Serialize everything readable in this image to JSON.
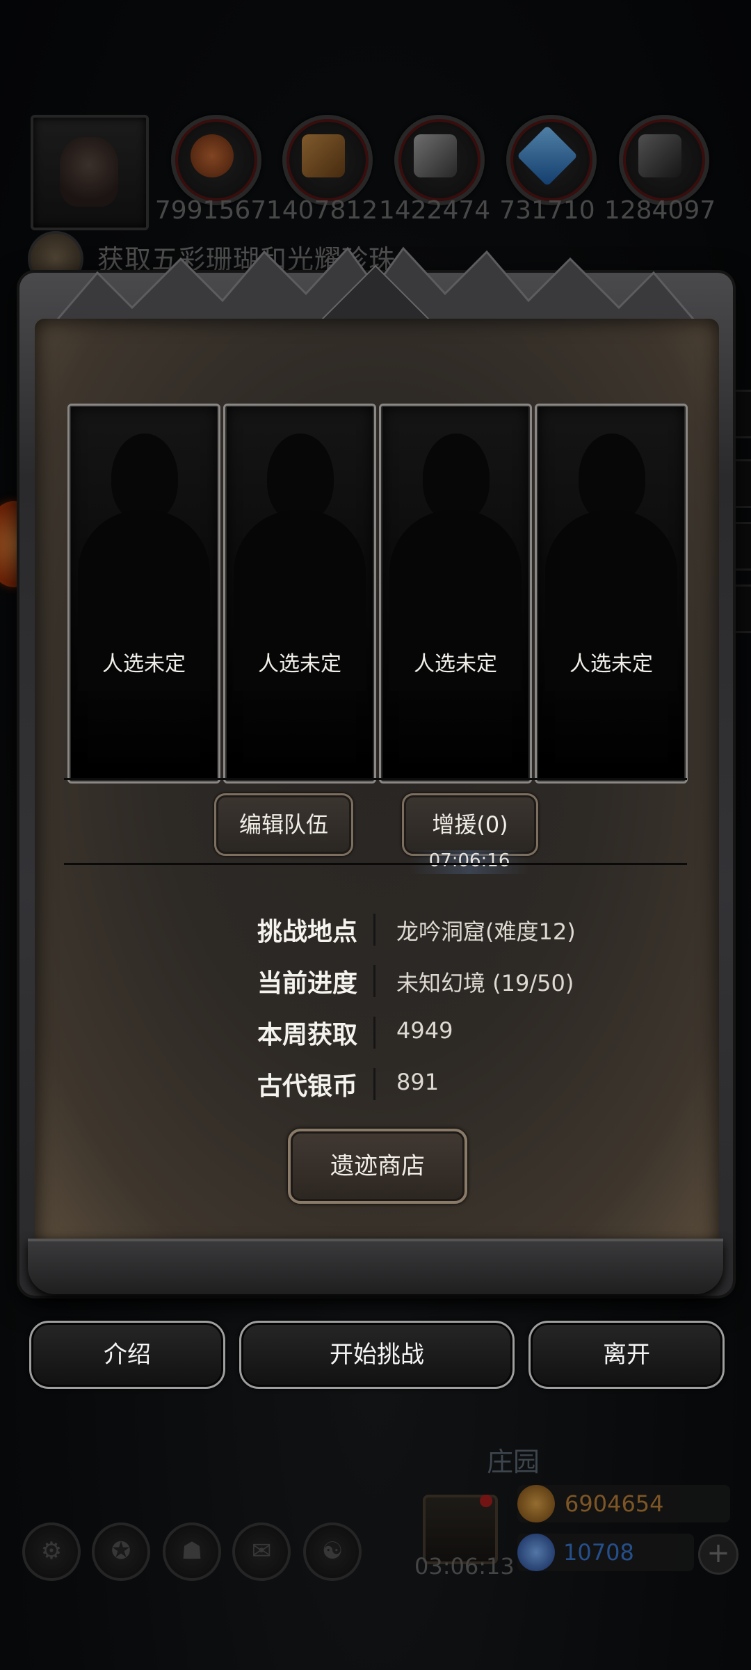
{
  "top_bar": {
    "player_portrait_icon": "demon-portrait",
    "resources": [
      {
        "icon": "meat-icon",
        "value": "7991567",
        "color": "#b5582a"
      },
      {
        "icon": "wood-icon",
        "value": "1407812",
        "color": "#a8763a"
      },
      {
        "icon": "stone-icon",
        "value": "1422474",
        "color": "#8a8a8a"
      },
      {
        "icon": "crystal-icon",
        "value": "731710",
        "color": "#3a8fd6"
      },
      {
        "icon": "iron-icon",
        "value": "1284097",
        "color": "#6b6b6b"
      }
    ],
    "quest_text": "获取五彩珊瑚和光耀珍珠"
  },
  "panel": {
    "slots": [
      {
        "label": "人选未定"
      },
      {
        "label": "人选未定"
      },
      {
        "label": "人选未定"
      },
      {
        "label": "人选未定"
      }
    ],
    "edit_team_label": "编辑队伍",
    "reinforce_label": "增援(0)",
    "reinforce_timer": "07:06:16",
    "info": [
      {
        "label": "挑战地点",
        "value": "龙吟洞窟(难度12)"
      },
      {
        "label": "当前进度",
        "value": "未知幻境 (19/50)"
      },
      {
        "label": "本周获取",
        "value": "4949"
      },
      {
        "label": "古代银币",
        "value": "891"
      }
    ],
    "shop_label": "遗迹商店"
  },
  "actions": {
    "intro_label": "介绍",
    "start_label": "开始挑战",
    "leave_label": "离开"
  },
  "background": {
    "manor_label": "庄园",
    "gift_timer": "03:06:13",
    "gold_value": "6904654",
    "gem_value": "10708",
    "gold_color": "#c2843a",
    "gem_color": "#3a7ad6"
  }
}
